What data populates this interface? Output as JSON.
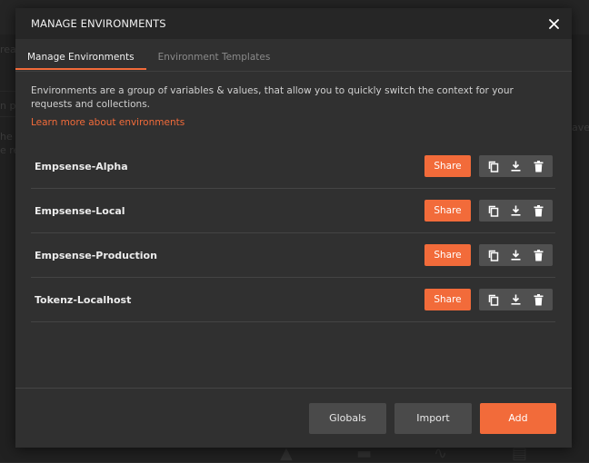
{
  "background": {
    "fragments": [
      "rea",
      "n pa",
      "he",
      "e re",
      "ave"
    ]
  },
  "modal": {
    "title": "MANAGE ENVIRONMENTS",
    "close_icon": "close-icon",
    "tabs": [
      {
        "label": "Manage Environments",
        "active": true
      },
      {
        "label": "Environment Templates",
        "active": false
      }
    ],
    "description": "Environments are a group of variables & values, that allow you to quickly switch the context for your requests and collections.",
    "learn_link": "Learn more about environments",
    "environments": [
      {
        "name": "Empsense-Alpha",
        "share_label": "Share"
      },
      {
        "name": "Empsense-Local",
        "share_label": "Share"
      },
      {
        "name": "Empsense-Production",
        "share_label": "Share"
      },
      {
        "name": "Tokenz-Localhost",
        "share_label": "Share"
      }
    ],
    "row_icons": [
      "duplicate-icon",
      "download-icon",
      "delete-icon"
    ],
    "footer": {
      "globals_label": "Globals",
      "import_label": "Import",
      "add_label": "Add"
    }
  },
  "colors": {
    "accent": "#f26b3a",
    "modal_bg": "#303030",
    "header_bg": "#262626"
  }
}
